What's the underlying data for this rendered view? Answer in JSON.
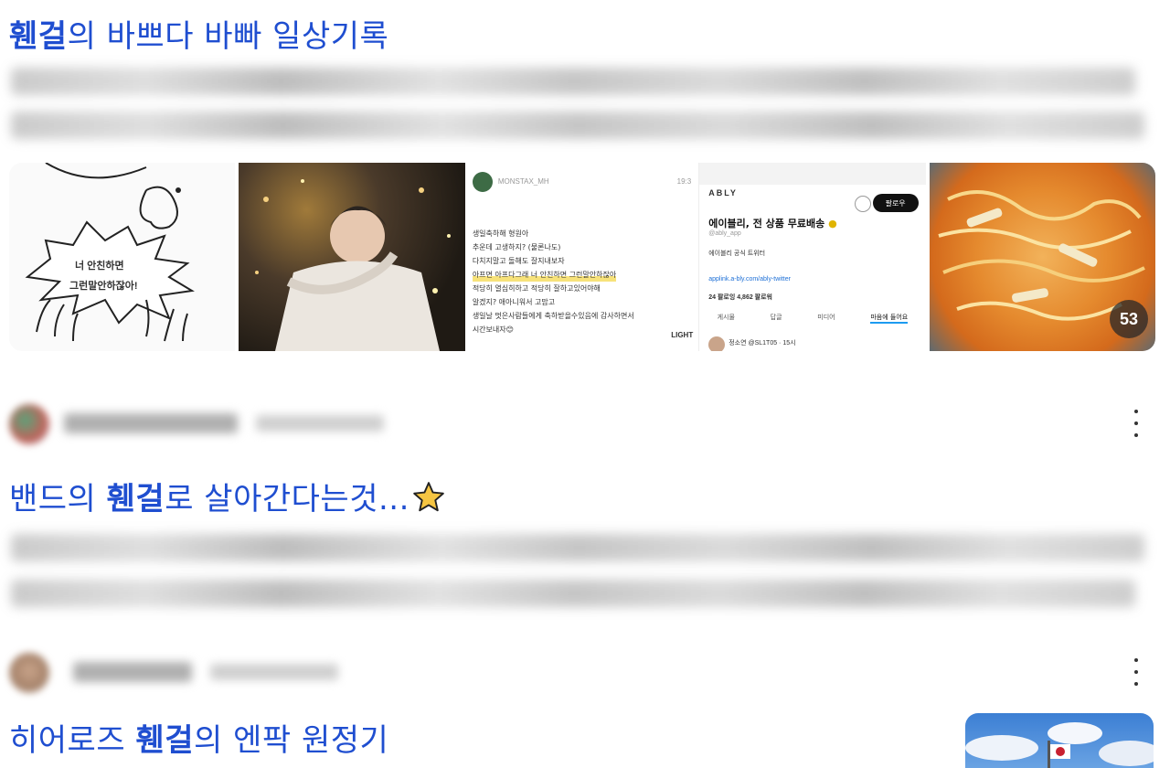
{
  "results": [
    {
      "title_parts": [
        "",
        "휀걸",
        "의 바쁘다 바빠 일상기록"
      ],
      "gallery": {
        "t1_bubble_line1": "너 안친하면",
        "t1_bubble_line2": "그런말안하잖아!",
        "t3_username": "MONSTAX_MH",
        "t3_time": "19:3",
        "t3_lines": [
          "생일축하해 형원아",
          "추운데 고생하지? (물론나도)",
          "다치지말고 돌해도 잘지내보자",
          "아프면 아프다그래 너 안친하면 그런말안하잖아",
          "적당히 열심히하고 적당히 잘하고있어야해",
          "알겠지? 애아니워서 고맙고",
          "생일날 멋은사람들에게 축하받을수있음에 감사하면서",
          "시간보내자😊"
        ],
        "t3_footer": "LIGHT",
        "t4_brand": "ABLY",
        "t4_follow": "팔로우",
        "t4_title": "에이블리, 전 상품 무료배송",
        "t4_handle": "@ably_app",
        "t4_desc": "에이블리 공식 트위터",
        "t4_link": "applink.a-bly.com/ably-twitter",
        "t4_stats": "24 팔로잉  4,862 팔로워",
        "t4_tabs": [
          "게시물",
          "답글",
          "미디어",
          "마음에 들어요"
        ],
        "t4_reply": "정소연 @SL1T05 · 15시",
        "more_count": "53"
      }
    },
    {
      "title_parts": [
        "밴드의 ",
        "휀걸",
        "로 살아간다는것..."
      ],
      "title_suffix_icon": "star-icon"
    },
    {
      "title_parts": [
        "히어로즈 ",
        "휀걸",
        "의 엔팍 원정기"
      ]
    }
  ],
  "colors": {
    "title": "#1f4ed0",
    "star": "#f5c542"
  }
}
